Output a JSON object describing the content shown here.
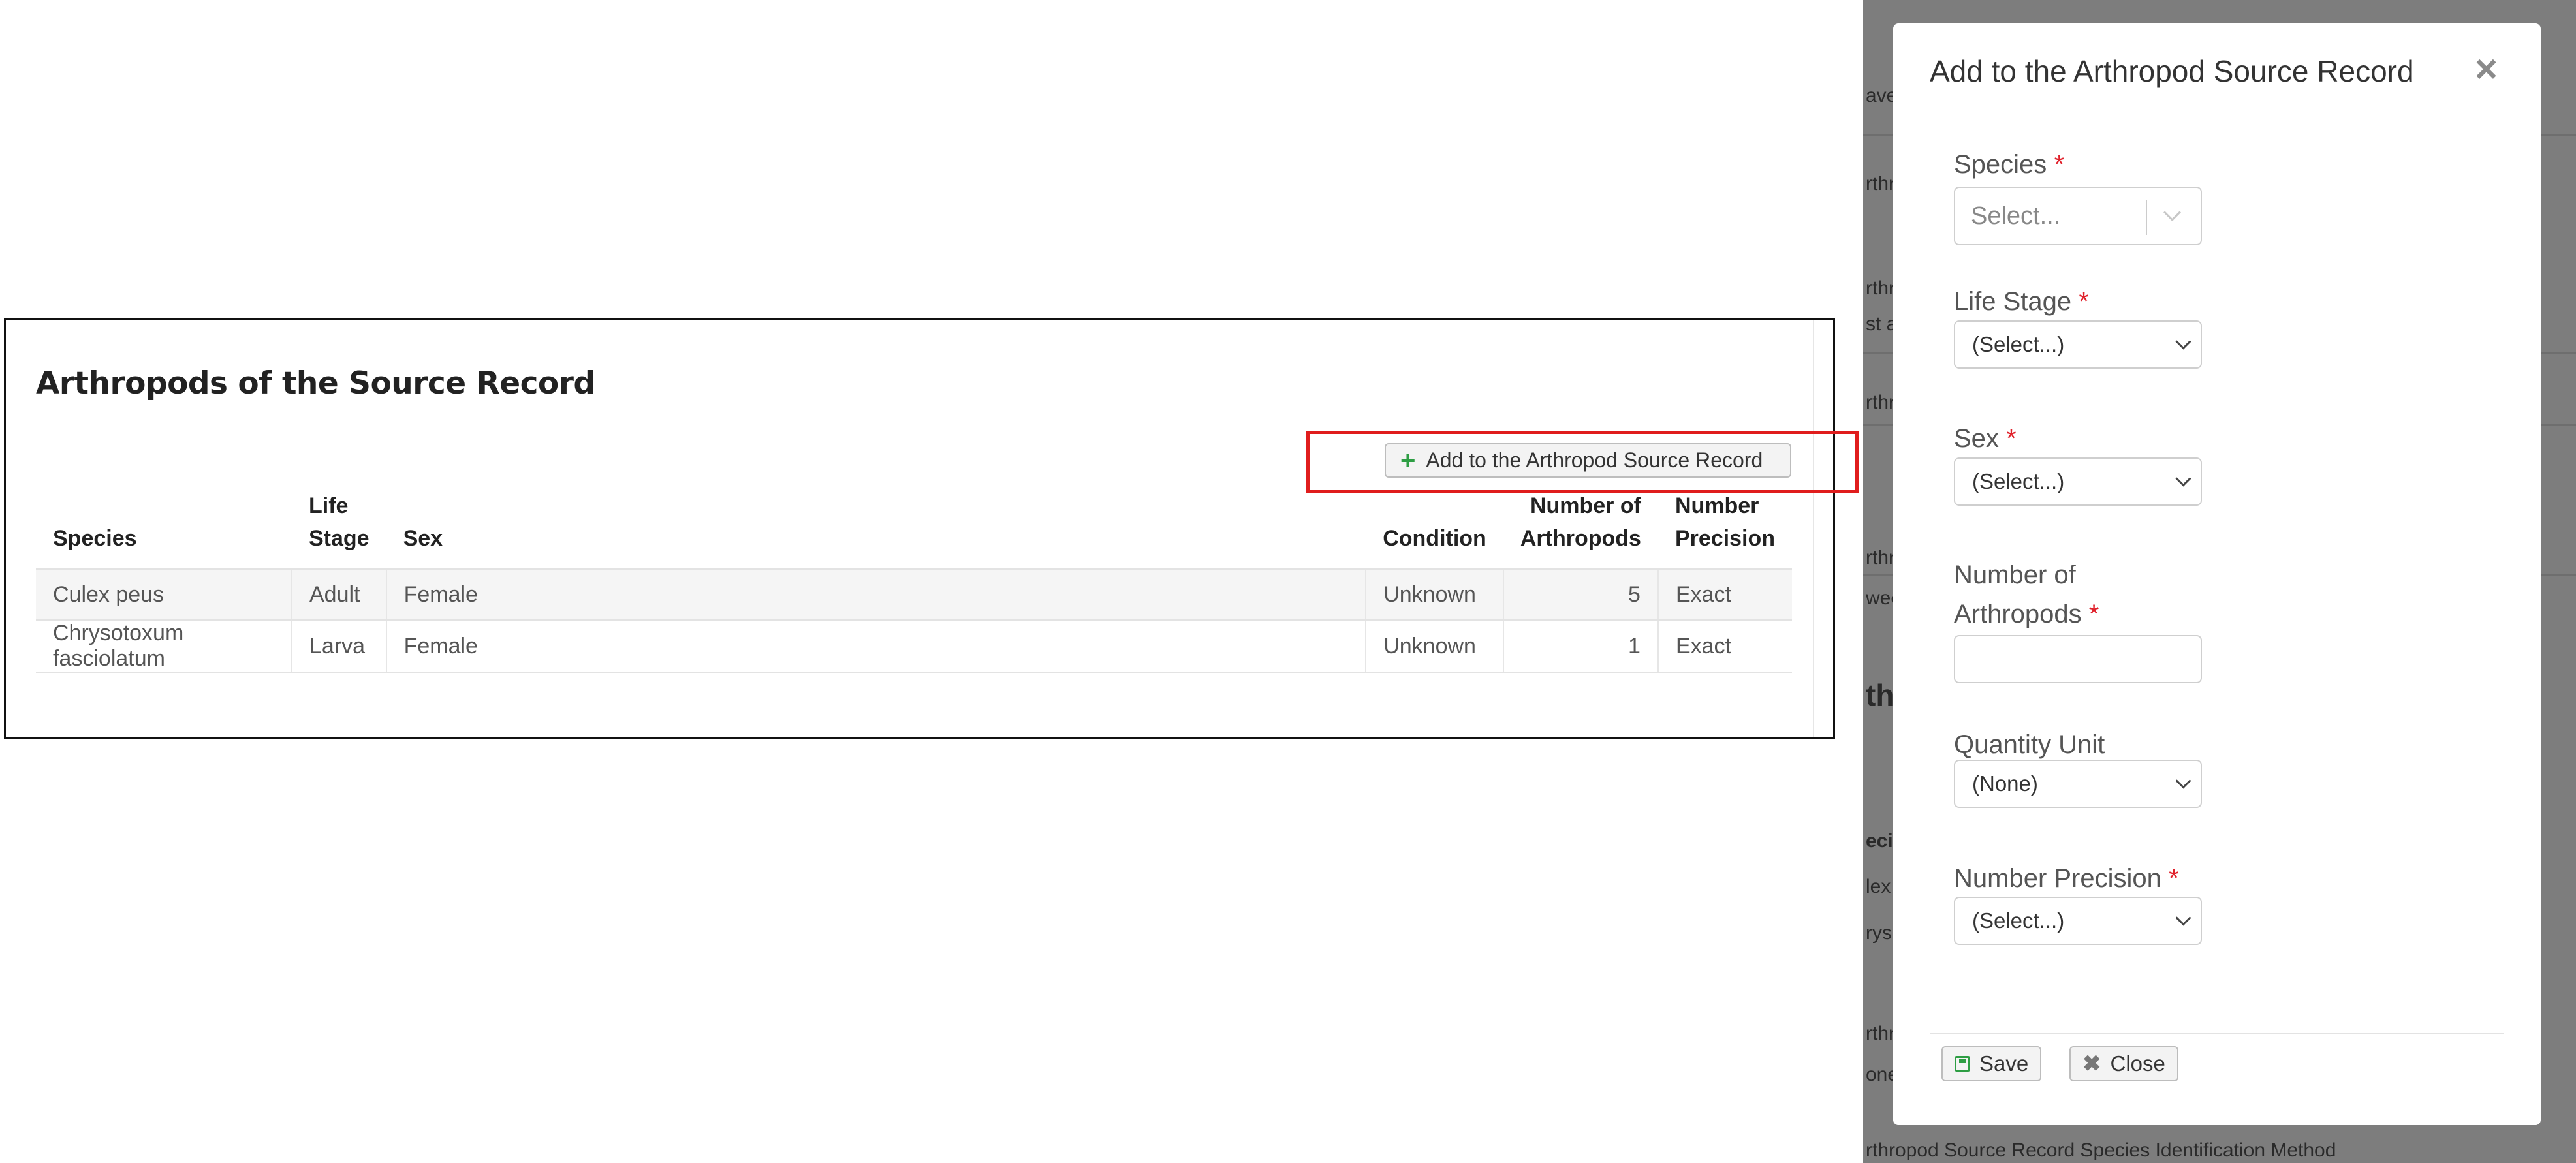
{
  "panel": {
    "title": "Arthropods of the Source Record",
    "add_button_label": "Add to the Arthropod Source Record",
    "table": {
      "headers": [
        "Species",
        "Life Stage",
        "Sex",
        "Condition",
        "Number of Arthropods",
        "Number Precision"
      ],
      "rows": [
        {
          "species": "Culex peus",
          "life_stage": "Adult",
          "sex": "Female",
          "condition": "Unknown",
          "number": "5",
          "precision": "Exact"
        },
        {
          "species": "Chrysotoxum fasciolatum",
          "life_stage": "Larva",
          "sex": "Female",
          "condition": "Unknown",
          "number": "1",
          "precision": "Exact"
        }
      ]
    }
  },
  "background_fragments": {
    "f1": "ave",
    "f2": "rthr",
    "f3": "rthr",
    "f4": "st a",
    "f5": "rthr",
    "f6": "rthr",
    "f7": "wee",
    "f8": "thr",
    "f9": "ecie",
    "f10": "lex",
    "f11": "rysc",
    "f12": "rthr",
    "f13": "one",
    "f14": "rthropod Source Record Species Identification Method"
  },
  "modal": {
    "title": "Add to the Arthropod Source Record",
    "required_mark": "*",
    "fields": {
      "species": {
        "label": "Species",
        "placeholder": "Select..."
      },
      "life_stage": {
        "label": "Life Stage",
        "value": "(Select...)"
      },
      "sex": {
        "label": "Sex",
        "value": "(Select...)"
      },
      "number_of_arthropods": {
        "label_line1": "Number of",
        "label_line2": "Arthropods",
        "value": ""
      },
      "quantity_unit": {
        "label": "Quantity Unit",
        "value": "(None)"
      },
      "number_precision": {
        "label": "Number Precision",
        "value": "(Select...)"
      }
    },
    "save_label": "Save",
    "close_label": "Close"
  },
  "colors": {
    "highlight": "#e01d1d",
    "required": "#e0202a",
    "plus_icon": "#2e9e44",
    "overlay": "#7d7d7d"
  }
}
